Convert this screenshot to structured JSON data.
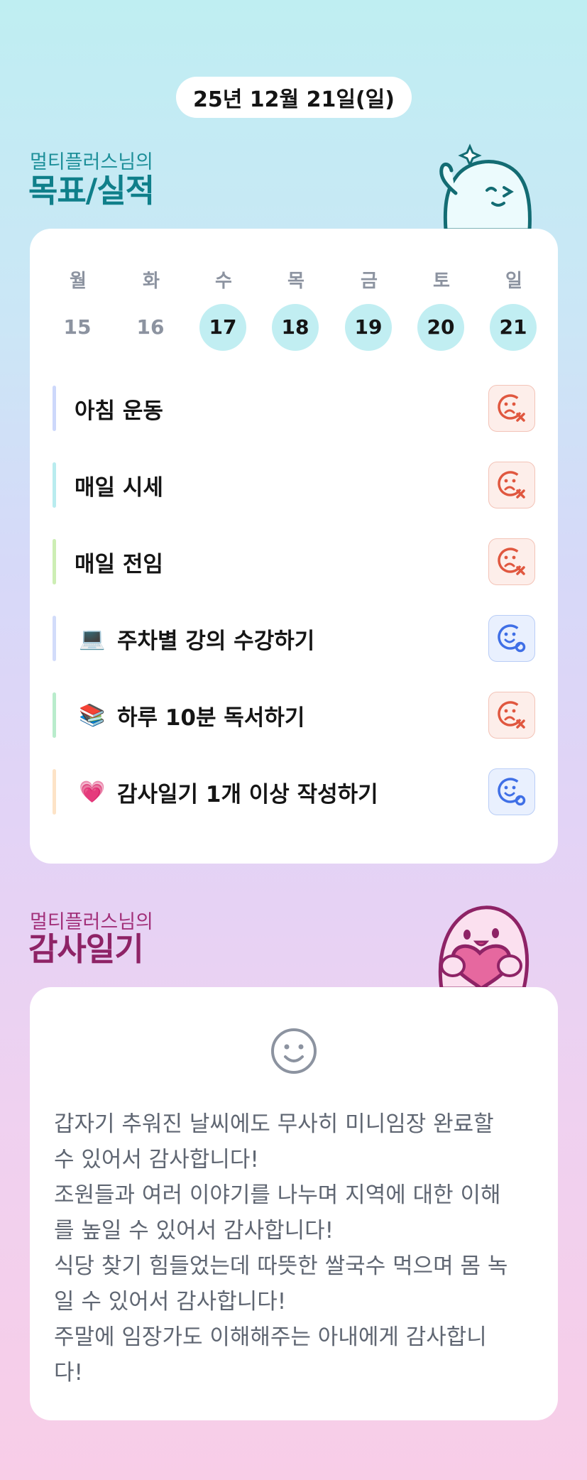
{
  "header": {
    "date": "25년 12월 21일(일)"
  },
  "goals_section": {
    "subtitle": "멀티플러스님의",
    "title": "목표/실적"
  },
  "week": [
    {
      "weekday": "월",
      "date": "15",
      "active": false
    },
    {
      "weekday": "화",
      "date": "16",
      "active": false
    },
    {
      "weekday": "수",
      "date": "17",
      "active": true
    },
    {
      "weekday": "목",
      "date": "18",
      "active": true
    },
    {
      "weekday": "금",
      "date": "19",
      "active": true
    },
    {
      "weekday": "토",
      "date": "20",
      "active": true
    },
    {
      "weekday": "일",
      "date": "21",
      "active": true
    }
  ],
  "goals": [
    {
      "label": "아침 운동",
      "emoji": "",
      "bar_color": "#cdd8fb",
      "status": "fail"
    },
    {
      "label": "매일 시세",
      "emoji": "",
      "bar_color": "#b9ecef",
      "status": "fail"
    },
    {
      "label": "매일 전임",
      "emoji": "",
      "bar_color": "#cdeeb4",
      "status": "fail"
    },
    {
      "label": "주차별 강의 수강하기",
      "emoji": "💻",
      "bar_color": "#d2dcfa",
      "status": "ok"
    },
    {
      "label": "하루 10분 독서하기",
      "emoji": "📚",
      "bar_color": "#b9eccc",
      "status": "fail"
    },
    {
      "label": "감사일기 1개 이상 작성하기",
      "emoji": "💗",
      "bar_color": "#fde3c7",
      "status": "ok"
    }
  ],
  "gratitude_section": {
    "subtitle": "멀티플러스님의",
    "title": "감사일기"
  },
  "gratitude": {
    "mood_icon": "smile-face-icon",
    "lines": [
      "갑자기 추워진 날씨에도 무사히 미니임장 완료할",
      "수 있어서 감사합니다!",
      "조원들과 여러 이야기를 나누며 지역에 대한 이해",
      "를 높일 수 있어서 감사합니다!",
      "식당 찾기 힘들었는데 따뜻한 쌀국수 먹으며 몸 녹",
      "일 수 있어서 감사합니다!",
      "주말에 임장가도 이해해주는 아내에게 감사합니",
      "다!"
    ]
  },
  "colors": {
    "fail": "#e0573f",
    "ok": "#3f6fe6",
    "active_day": "#c1eef2"
  }
}
